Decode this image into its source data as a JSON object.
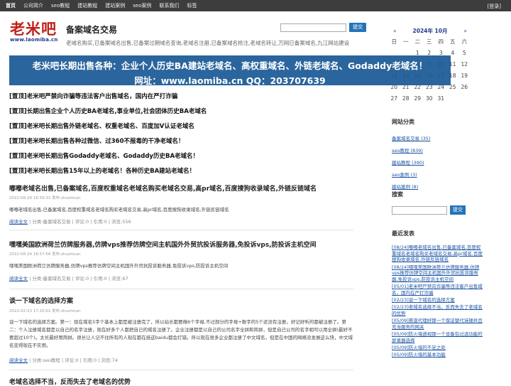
{
  "topnav": {
    "items": [
      "首页",
      "公司简介",
      "seo教程",
      "建站教程",
      "建站案例",
      "seo案例",
      "联系我们",
      "标签"
    ],
    "login": "[登录]"
  },
  "logo": {
    "main": "老米吧",
    "sub": "www.laomiba.cn"
  },
  "site": {
    "title": "备案域名交易",
    "description": "老域名购买,已备案域名出售,已备案过期域名查询,老域名注册,已备案域名抢注,老域名转让,万网已备案域名,九江网站建设"
  },
  "search": {
    "button": "提交"
  },
  "banner": {
    "line1": "老米吧长期出售各种：企业个人历史BA建站老域名、高权重域名、外链老域名、Godaddy老域名！",
    "line2": "网址：www.laomiba.cn QQ：203707639"
  },
  "calendar": {
    "prev": "«",
    "title": "2024年 10月",
    "next": "»",
    "weekdays": [
      "日",
      "一",
      "二",
      "三",
      "四",
      "五",
      "六"
    ],
    "weeks": [
      [
        "",
        "",
        "1",
        "2",
        "3",
        "4",
        "5"
      ],
      [
        "6",
        "7",
        "8",
        "9",
        "10",
        "11",
        "12"
      ],
      [
        "13",
        "14",
        "15",
        "16",
        "17",
        "18",
        "19"
      ],
      [
        "20",
        "21",
        "22",
        "23",
        "24",
        "25",
        "26"
      ],
      [
        "27",
        "28",
        "29",
        "30",
        "31",
        "",
        ""
      ]
    ]
  },
  "sticky": [
    "[置顶]老米吧严禁向诈骗等违法客户出售域名，国内在严打诈骗",
    "[置顶]长期出售企业个人历史BA老域名,事业单位,社会团体历史BA老域名",
    "[置顶]老米吧长期出售外链老域名、权重老域名、百度加V认证老域名",
    "[置顶]老米吧长期出售各种过微信、过360不报毒的干净老域名！",
    "[置顶]老米吧长期出售Godaddy老域名、Godaddy历史BA老域名！",
    "[置顶]老米吧长期出售15年以上的老域名！各种历史BA建站老域名！"
  ],
  "posts": [
    {
      "title": "嘟嘟老域名出售,已备案域名,百度权重域名老域名购买老域名交易,高pr域名,百度搜狗收录域名,外链反链域名",
      "meta": "2022-08-24 16:59:31 发布:zhushican",
      "excerpt": "嘟嘟老域名出售,已备案域名,百度权重域名老域名购买老域名交易,高pr域名,百度搜狗收录域名,外链反链域名",
      "more": "阅读全文",
      "foot": " | 分类:备案域名交易 | 评论:0 | 引用:0 | 浏览:556"
    },
    {
      "title": "嘿嘿美国欧洲荷兰仿牌服务器,仿牌vps推荐仿牌空间主机国外外贸抗投诉服务器,免投诉vps,防投诉主机空间",
      "meta": "2022-08-24 16:57:56 发布:zhushican",
      "excerpt": "嘿嘿美国欧洲荷兰仿牌服务器,仿牌vps推荐仿牌空间主机国外外贸抗投诉服务器,免投诉vps,防投诉主机空间",
      "more": "阅读全文",
      "foot": " | 分类:备案域名交易 | 评论:0 | 引用:0 | 浏览:67"
    },
    {
      "title": "谈一下域名的选择方案",
      "meta": "2022-02-23 17:20:01 发布:zhushican",
      "excerpt": "谈一下域名的选择方案。第一：现在域名5字个基本上都是被注册完了，所以站长都要做6个字母,不过部分的字母+数字的5个还没有注册，好记好听的都被注册了。第二：个人注册域名都是以自己的名字注册，现在好多个人都把自己的域名注册了。企业注册都是以自己的公司名字全拼和简拼，但是自己公司的名字相可以用全拼(最好不要超过10个)。太长最好用简拼。很长让人记不住所有的人现在都在挂这baidu都会打错。所以现在很多企业都注册了中文域名，但是在中国的网络没发展这么快，中文域名变得现在不实用。",
      "more": "阅读全文",
      "foot": " | 分类:seo教程 | 评论:0 | 引用:0 | 浏览:74"
    },
    {
      "title": "老域名选择不当，反而失去了老域名的优势",
      "meta": "",
      "excerpt": "",
      "more": "",
      "foot": ""
    }
  ],
  "sidebar": {
    "categories_title": "网站分类",
    "categories": [
      "备案域名交易 (35)",
      "seo教程 (839)",
      "建站教程 (390)",
      "seo案例 (3)",
      "建站案例 (8)"
    ],
    "search_title": "搜索",
    "search_button": "提交",
    "recent_title": "最近发表",
    "recent": [
      "[08/24]嘟嘟老域名出售,已备案域名,百度权重域名老域名购买老域名交易,高pr域名,百度搜狗收录域名,外链反链域名",
      "[08/24]嘿嘿美国欧洲荷兰仿牌服务器,仿牌vps推荐仿牌空间主机国外外贸抗投诉服务器,免投诉vps,防投诉主机空间",
      "[05/01]老米吧严禁向诈骗等违法客户出售域名，国内在严打诈骗",
      "[02/23]谈一下域名的选择方案",
      "[02/23]老域名选择不当，反而失去了老域名的优势",
      "[05/09]蒸谱代理好那一个保证替代诗操并且充当服务的网关",
      "[05/09]防火墙透视那一个设备包过滤功能的屏录器选择",
      "[05/09]防火墙的不足之处",
      "[05/09]防火墙的基本功能"
    ]
  },
  "colors": {
    "topbar": "#3d3d3d",
    "banner": "#1c5a96",
    "button": "#2673b8",
    "logo_red": "#c0211b",
    "link": "#1d55a5"
  }
}
